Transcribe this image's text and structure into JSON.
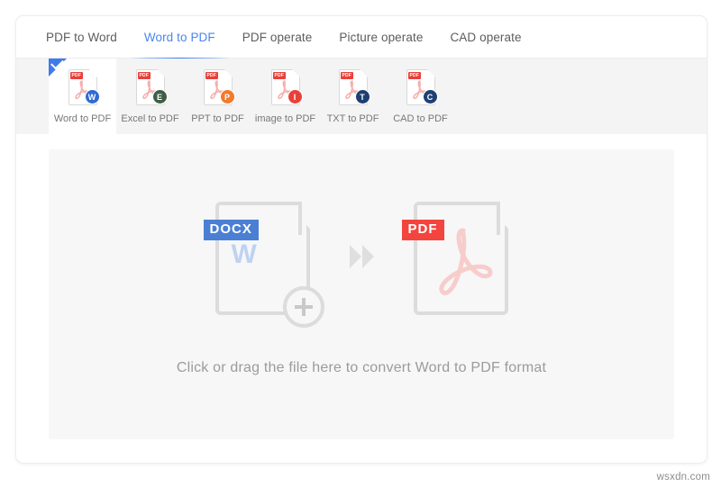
{
  "tabs": [
    {
      "label": "PDF to Word",
      "active": false
    },
    {
      "label": "Word to PDF",
      "active": true
    },
    {
      "label": "PDF operate",
      "active": false
    },
    {
      "label": "Picture operate",
      "active": false
    },
    {
      "label": "CAD operate",
      "active": false
    }
  ],
  "tools": [
    {
      "label": "Word to PDF",
      "tag": "PDF",
      "badge": "W",
      "badge_color": "#2f6bd4",
      "selected": true,
      "icon": "word-to-pdf-icon"
    },
    {
      "label": "Excel to PDF",
      "tag": "PDF",
      "badge": "E",
      "badge_color": "#3f5e45",
      "selected": false,
      "icon": "excel-to-pdf-icon"
    },
    {
      "label": "PPT to PDF",
      "tag": "PDF",
      "badge": "P",
      "badge_color": "#f07a2e",
      "selected": false,
      "icon": "ppt-to-pdf-icon"
    },
    {
      "label": "image to PDF",
      "tag": "PDF",
      "badge": "I",
      "badge_color": "#e8413a",
      "selected": false,
      "icon": "image-to-pdf-icon"
    },
    {
      "label": "TXT to PDF",
      "tag": "PDF",
      "badge": "T",
      "badge_color": "#1d3f72",
      "selected": false,
      "icon": "txt-to-pdf-icon"
    },
    {
      "label": "CAD to PDF",
      "tag": "PDF",
      "badge": "C",
      "badge_color": "#1d3f72",
      "selected": false,
      "icon": "cad-to-pdf-icon"
    }
  ],
  "dropzone": {
    "source_tag": "DOCX",
    "target_tag": "PDF",
    "instruction": "Click or drag the file here to convert Word to PDF format",
    "source_glyph": "W"
  },
  "watermark": "wsxdn.com",
  "colors": {
    "accent": "#4a86ee",
    "docx_tag": "#4a7fd4",
    "pdf_tag": "#f3453e",
    "toolstrip_bg": "#f4f4f4",
    "dropzone_bg": "#f7f7f8"
  }
}
